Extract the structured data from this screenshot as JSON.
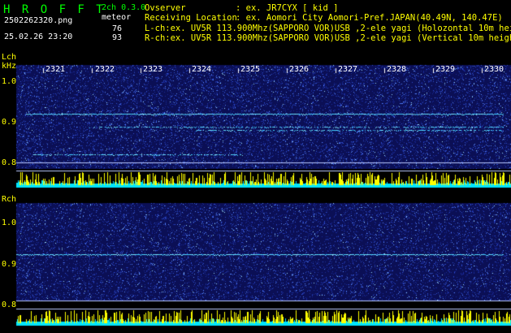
{
  "header": {
    "app_title": "H R O F F T",
    "mode": "2ch 0.3.0",
    "file_name": "2502262320.png",
    "meteor_label": "meteor",
    "timestamp": "25.02.26 23:20",
    "count_l": "76",
    "count_r": "93",
    "observer_label": "Ovserver",
    "observer_value": ": ex. JR7CYX [ kid ]",
    "location_label": "Receiving Location",
    "location_value": ": ex. Aomori City Aomori-Pref.JAPAN(40.49N, 140.47E)",
    "lch_info": "L-ch:ex. UV5R 113.900Mhz(SAPPORO VOR)USB ,2-ele yagi (Holozontal 10m height)",
    "rch_info": "R-ch:ex. UV5R 113.900Mhz(SAPPORO VOR)USB ,2-ele yagi (Vertical 10m height)"
  },
  "panels": {
    "lch": {
      "label": "Lch",
      "unit": "kHz",
      "yticks": [
        "1.0",
        "0.9",
        "0.8"
      ],
      "time_ticks": [
        "2321",
        "2322",
        "2323",
        "2324",
        "2325",
        "2326",
        "2327",
        "2328",
        "2329",
        "2330"
      ]
    },
    "rch": {
      "label": "Rch",
      "yticks": [
        "1.0",
        "0.9",
        "0.8"
      ]
    }
  },
  "colors": {
    "title": "#00ff00",
    "label": "#ffff00",
    "background_noise": "#0b0f55",
    "signal_line": "#3fd0ff",
    "activity_cyan": "#00e5ff",
    "activity_yellow": "#ffff00"
  }
}
